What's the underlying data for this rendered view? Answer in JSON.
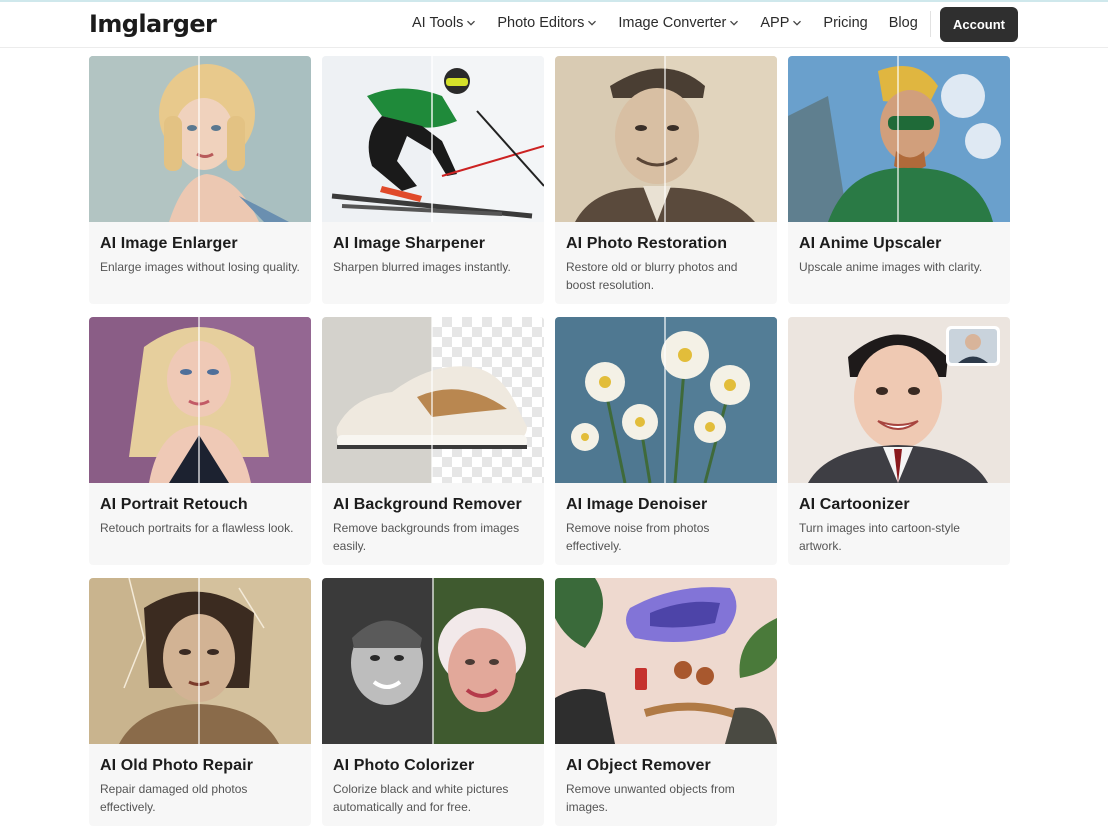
{
  "header": {
    "logo": "Imglarger",
    "nav": [
      {
        "label": "AI Tools",
        "dropdown": true
      },
      {
        "label": "Photo Editors",
        "dropdown": true
      },
      {
        "label": "Image Converter",
        "dropdown": true
      },
      {
        "label": "APP",
        "dropdown": true
      },
      {
        "label": "Pricing",
        "dropdown": false
      },
      {
        "label": "Blog",
        "dropdown": false
      }
    ],
    "account_label": "Account"
  },
  "cards": [
    {
      "title": "AI Image Enlarger",
      "desc": "Enlarge images without losing quality."
    },
    {
      "title": "AI Image Sharpener",
      "desc": "Sharpen blurred images instantly."
    },
    {
      "title": "AI Photo Restoration",
      "desc": "Restore old or blurry photos and boost resolution."
    },
    {
      "title": "AI Anime Upscaler",
      "desc": "Upscale anime images with clarity."
    },
    {
      "title": "AI Portrait Retouch",
      "desc": "Retouch portraits for a flawless look."
    },
    {
      "title": "AI Background Remover",
      "desc": "Remove backgrounds from images easily."
    },
    {
      "title": "AI Image Denoiser",
      "desc": "Remove noise from photos effectively."
    },
    {
      "title": "AI Cartoonizer",
      "desc": "Turn images into cartoon-style artwork."
    },
    {
      "title": "AI Old Photo Repair",
      "desc": "Repair damaged old photos effectively."
    },
    {
      "title": "AI Photo Colorizer",
      "desc": "Colorize black and white pictures automatically and for free."
    },
    {
      "title": "AI Object Remover",
      "desc": "Remove unwanted objects from images."
    }
  ],
  "colors": {
    "account_bg": "#2f2f2f",
    "card_bg": "#f7f7f7",
    "text_primary": "#1c1c1c",
    "text_secondary": "#555555"
  }
}
